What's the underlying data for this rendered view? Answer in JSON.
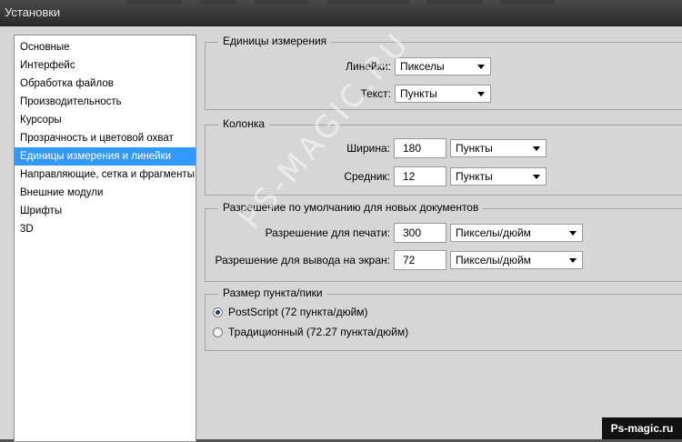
{
  "window": {
    "title": "Установки"
  },
  "sidebar": {
    "items": [
      {
        "label": "Основные"
      },
      {
        "label": "Интерфейс"
      },
      {
        "label": "Обработка файлов"
      },
      {
        "label": "Производительность"
      },
      {
        "label": "Курсоры"
      },
      {
        "label": "Прозрачность и цветовой охват"
      },
      {
        "label": "Единицы измерения и линейки",
        "selected": true
      },
      {
        "label": "Направляющие, сетка и фрагменты"
      },
      {
        "label": "Внешние модули"
      },
      {
        "label": "Шрифты"
      },
      {
        "label": "3D"
      }
    ]
  },
  "units": {
    "legend": "Единицы измерения",
    "rulers_label": "Линейки:",
    "rulers_value": "Пикселы",
    "text_label": "Текст:",
    "text_value": "Пункты"
  },
  "column": {
    "legend": "Колонка",
    "width_label": "Ширина:",
    "width_value": "180",
    "width_unit": "Пункты",
    "gutter_label": "Средник:",
    "gutter_value": "12",
    "gutter_unit": "Пункты"
  },
  "resolution": {
    "legend": "Разрешение по умолчанию для новых документов",
    "print_label": "Разрешение для печати:",
    "print_value": "300",
    "print_unit": "Пикселы/дюйм",
    "screen_label": "Разрешение для вывода на экран:",
    "screen_value": "72",
    "screen_unit": "Пикселы/дюйм"
  },
  "point_size": {
    "legend": "Размер пункта/пики",
    "options": [
      {
        "label": "PostScript (72 пункта/дюйм)",
        "checked": true
      },
      {
        "label": "Традиционный (72.27 пункта/дюйм)",
        "checked": false
      }
    ]
  },
  "watermark": "PS-MAGIC.RU",
  "brand": "Ps-magic.ru"
}
